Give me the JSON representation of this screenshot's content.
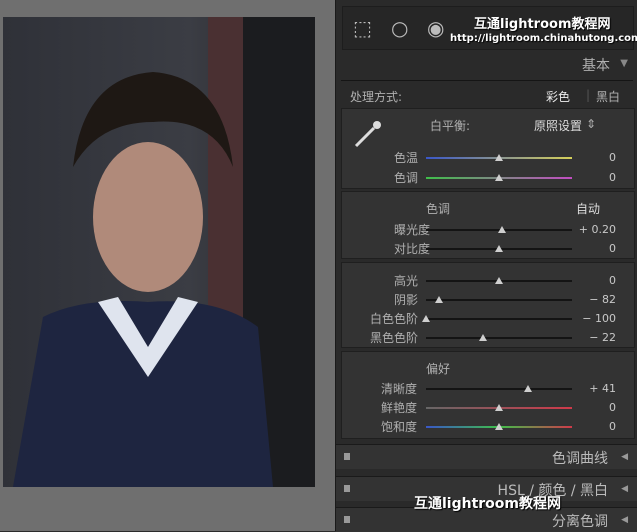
{
  "watermark": {
    "site": "互通lightroom教程网",
    "url": "http://lightroom.chinahutong.com/"
  },
  "basic": {
    "title": "基本",
    "treatment": {
      "label": "处理方式:",
      "color": "彩色",
      "bw": "黑白"
    },
    "wb": {
      "label": "白平衡:",
      "value": "原照设置"
    },
    "temp": {
      "label": "色温",
      "value": "0",
      "pos": 0.5
    },
    "tint": {
      "label": "色调",
      "value": "0",
      "pos": 0.5
    },
    "tone": {
      "label": "色调",
      "auto": "自动"
    },
    "exposure": {
      "label": "曝光度",
      "value": "+ 0.20",
      "pos": 0.52
    },
    "contrast": {
      "label": "对比度",
      "value": "0",
      "pos": 0.5
    },
    "highlights": {
      "label": "高光",
      "value": "0",
      "pos": 0.5
    },
    "shadows": {
      "label": "阴影",
      "value": "− 82",
      "pos": 0.09
    },
    "whites": {
      "label": "白色色阶",
      "value": "− 100",
      "pos": 0.0
    },
    "blacks": {
      "label": "黑色色阶",
      "value": "− 22",
      "pos": 0.39
    },
    "presence": {
      "label": "偏好"
    },
    "clarity": {
      "label": "清晰度",
      "value": "+ 41",
      "pos": 0.7
    },
    "vibrance": {
      "label": "鲜艳度",
      "value": "0",
      "pos": 0.5
    },
    "saturation": {
      "label": "饱和度",
      "value": "0",
      "pos": 0.5
    }
  },
  "panels": {
    "tone_curve": "色调曲线",
    "hsl": "HSL / 颜色 / 黑白",
    "split": "分离色调"
  },
  "wechat_label": "互通lightroom教程网"
}
